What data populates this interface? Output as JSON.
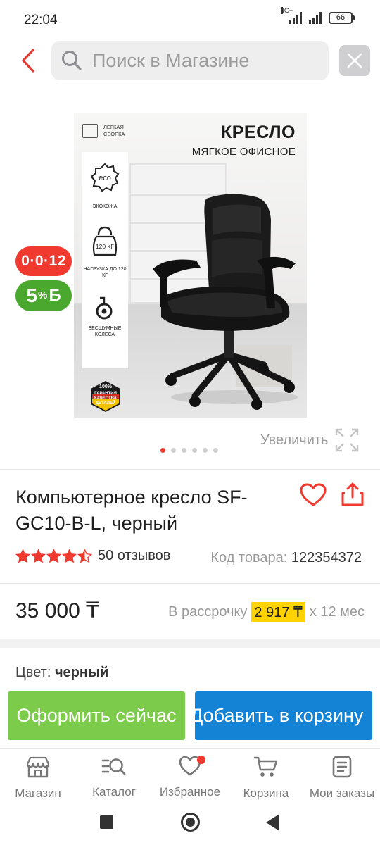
{
  "status": {
    "time": "22:04",
    "network": "4G+",
    "battery": "66"
  },
  "search": {
    "placeholder": "Поиск в Магазине"
  },
  "product_image": {
    "title": "КРЕСЛО",
    "subtitle": "МЯГКОЕ ОФИСНОЕ",
    "assembly": "ЛЁГКАЯ СБОРКА",
    "features": [
      {
        "icon": "eco",
        "label": "ЭКОКОЖА"
      },
      {
        "icon": "120 КГ",
        "label": "НАГРУЗКА ДО 120 КГ"
      },
      {
        "label": "БЕСШУМНЫЕ КОЛЕСА"
      }
    ],
    "badge": {
      "percent": "100%",
      "text": "ГАРАНТИЯ КАЧЕСТВА ДЕТАЛЕЙ"
    },
    "slides_count": 6,
    "active_slide": 0
  },
  "promo": {
    "installment": "0·0·12",
    "bonus_percent": "5",
    "bonus_sign": "%",
    "bonus_currency": "Б"
  },
  "zoom_label": "Увеличить",
  "product": {
    "title": "Компьютерное кресло SF-GC10-B-L, черный",
    "rating": 4.5,
    "reviews": "50 отзывов",
    "code_label": "Код товара:",
    "code_value": "122354372",
    "price": "35 000 ₸",
    "installment_prefix": "В рассрочку",
    "installment_amount": "2 917 ₸",
    "installment_suffix": "x 12 мес",
    "color_label": "Цвет:",
    "color_value": "черный"
  },
  "buttons": {
    "buy_now": "Оформить сейчас",
    "add_to_cart": "Добавить в корзину"
  },
  "nav": [
    {
      "label": "Магазин",
      "icon": "shop-icon"
    },
    {
      "label": "Каталог",
      "icon": "catalog-icon"
    },
    {
      "label": "Избранное",
      "icon": "heart-icon"
    },
    {
      "label": "Корзина",
      "icon": "cart-icon"
    },
    {
      "label": "Мои заказы",
      "icon": "orders-icon"
    }
  ],
  "colors": {
    "accent": "#f03a30",
    "buy": "#7dcb4a",
    "cart": "#1482d5",
    "bonus": "#4aa82f",
    "installment_highlight": "#ffd200"
  }
}
